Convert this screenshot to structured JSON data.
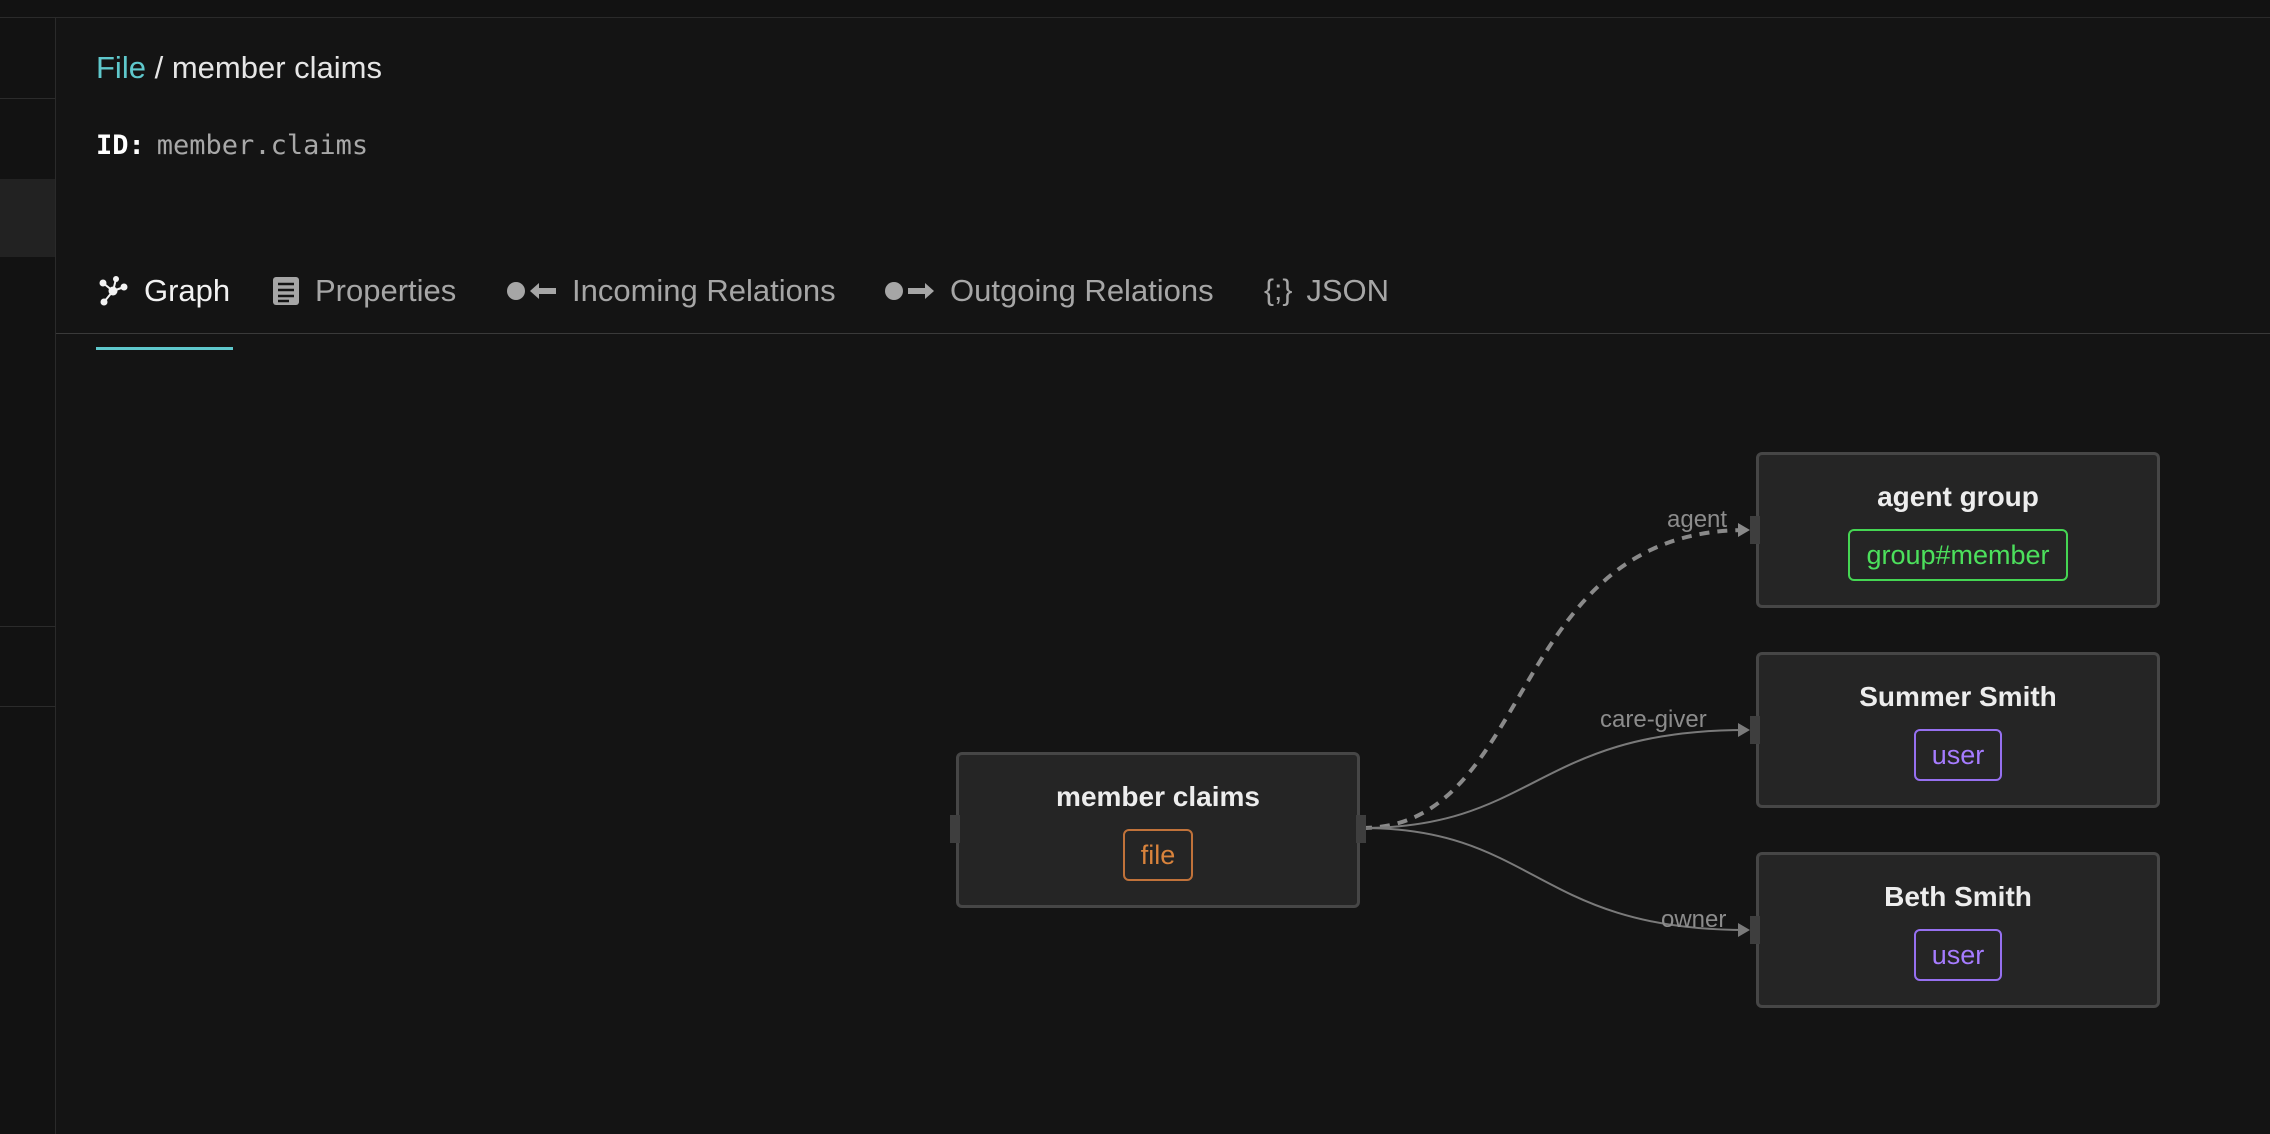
{
  "breadcrumb": {
    "parent": "File",
    "separator": "/",
    "current": "member claims"
  },
  "id_line": {
    "label": "ID:",
    "value": "member.claims"
  },
  "tabs": [
    {
      "label": "Graph",
      "icon": "graph-icon",
      "active": true
    },
    {
      "label": "Properties",
      "icon": "list-icon",
      "active": false
    },
    {
      "label": "Incoming Relations",
      "icon": "incoming-arrow-icon",
      "active": false
    },
    {
      "label": "Outgoing Relations",
      "icon": "outgoing-arrow-icon",
      "active": false
    },
    {
      "label": "JSON",
      "icon": "braces-icon",
      "glyph": "{;}",
      "active": false
    }
  ],
  "graph": {
    "source": {
      "title": "member claims",
      "type": "file"
    },
    "targets": [
      {
        "title": "agent group",
        "type": "group#member",
        "relation": "agent",
        "edge_style": "dashed"
      },
      {
        "title": "Summer Smith",
        "type": "user",
        "relation": "care-giver",
        "edge_style": "solid"
      },
      {
        "title": "Beth Smith",
        "type": "user",
        "relation": "owner",
        "edge_style": "solid"
      }
    ]
  },
  "colors": {
    "accent": "#5fc8cc",
    "file_badge": "#d9833c",
    "user_badge": "#a67cff",
    "group_badge": "#4ce05c",
    "background": "#141414",
    "node_background": "#252525"
  }
}
